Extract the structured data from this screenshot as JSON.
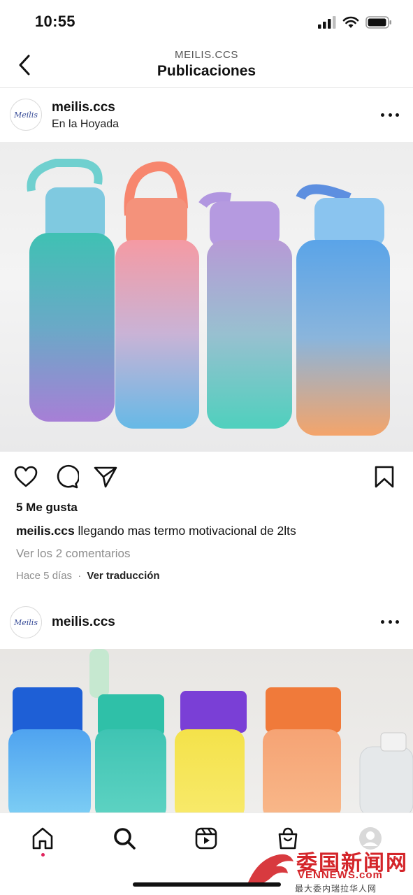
{
  "status_bar": {
    "time": "10:55"
  },
  "header": {
    "account": "MEILIS.CCS",
    "title": "Publicaciones"
  },
  "post1": {
    "avatar_text": "Meilis",
    "username": "meilis.ccs",
    "location": "En la Hoyada",
    "likes": "5 Me gusta",
    "caption_user": "meilis.ccs",
    "caption_text": "llegando mas termo motivacional de 2lts",
    "comments_link": "Ver los 2 comentarios",
    "time_ago": "Hace 5 días",
    "separator": "·",
    "translate": "Ver traducción"
  },
  "post2": {
    "avatar_text": "Meilis",
    "username": "meilis.ccs"
  },
  "watermark": {
    "chinese": "委国新闻网",
    "english": "VENNEWS.com",
    "subtitle": "最大委内瑞拉华人网"
  },
  "icons": {
    "back": "chevron-left-icon",
    "more": "more-horizontal-icon",
    "like": "heart-icon",
    "comment": "comment-icon",
    "share": "send-icon",
    "save": "bookmark-icon",
    "home": "home-icon",
    "search": "search-icon",
    "reels": "reels-icon",
    "shop": "shop-icon",
    "profile": "profile-icon"
  },
  "colors": {
    "accent_dot": "#e0245e",
    "watermark_red": "#d4252a"
  }
}
